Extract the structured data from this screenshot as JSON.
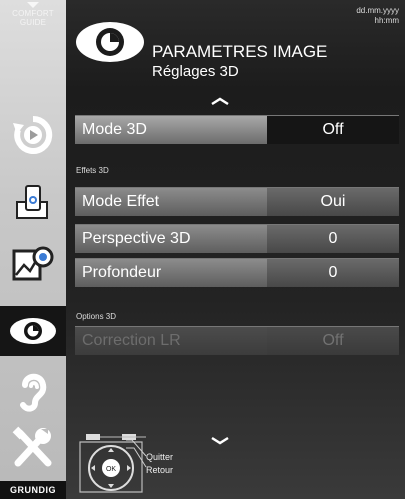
{
  "sidebar": {
    "comfort_guide_line1": "COMFORT",
    "comfort_guide_line2": "GUIDE",
    "brand": "GRUNDIG"
  },
  "header": {
    "date": "dd.mm.yyyy",
    "time": "hh:mm",
    "title": "PARAMETRES IMAGE",
    "subtitle": "Réglages 3D"
  },
  "sections": [
    "Effets 3D",
    "Options 3D"
  ],
  "rows": [
    {
      "label": "Mode 3D",
      "value": "Off"
    },
    {
      "label": "Mode Effet",
      "value": "Oui"
    },
    {
      "label": "Perspective 3D",
      "value": "0"
    },
    {
      "label": "Profondeur",
      "value": "0"
    },
    {
      "label": "Correction LR",
      "value": "Off"
    }
  ],
  "legend": {
    "exit": "Quitter",
    "back": "Retour"
  }
}
